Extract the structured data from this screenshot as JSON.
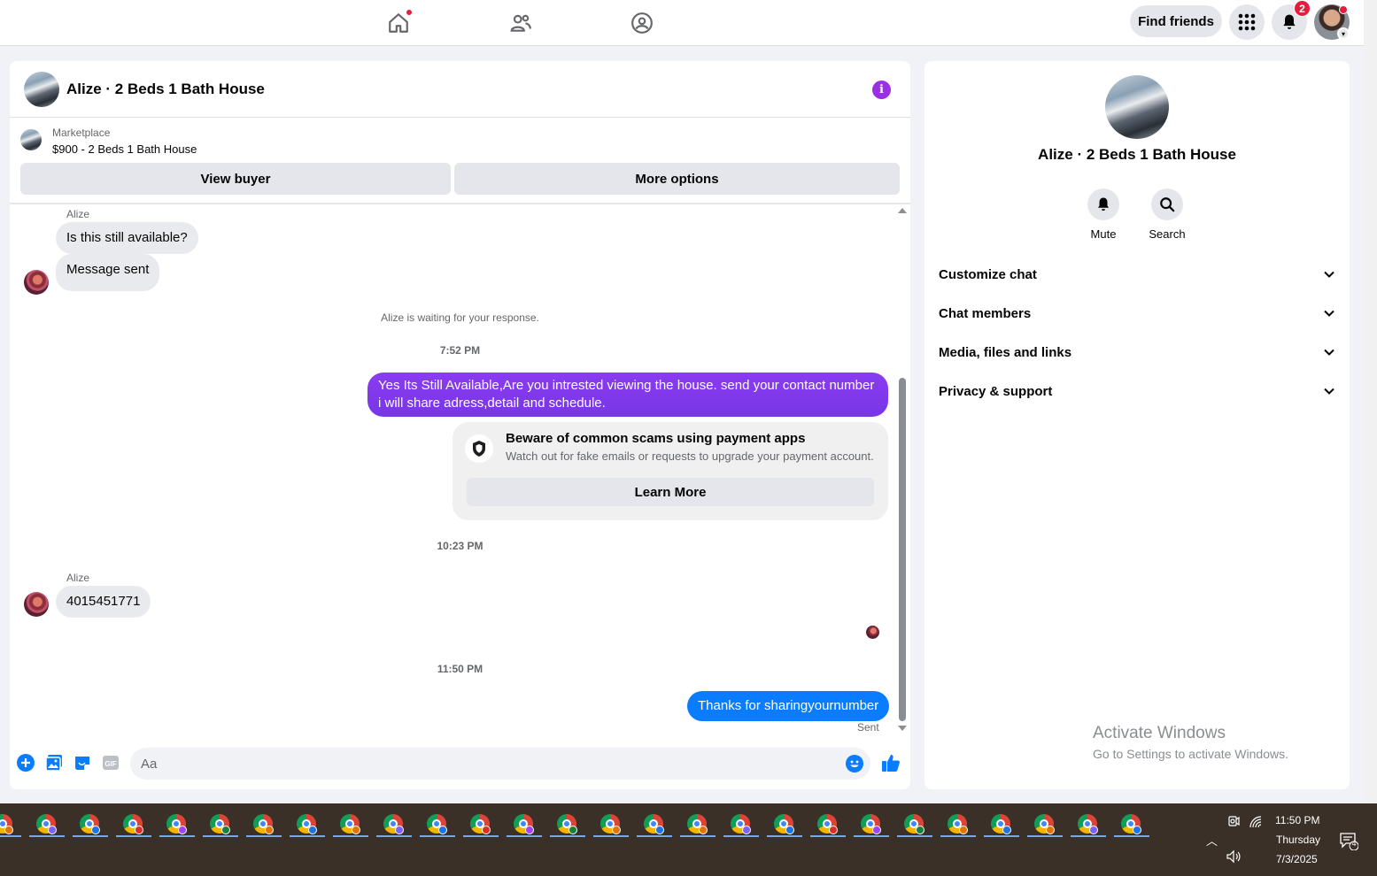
{
  "topbar": {
    "find_friends": "Find friends",
    "notification_count": "2",
    "nav_icons": [
      "home-icon",
      "friends-icon",
      "groups-icon"
    ]
  },
  "chat": {
    "title": "Alize · 2 Beds 1 Bath House",
    "marketplace_label": "Marketplace",
    "listing": "$900 - 2 Beds 1 Bath House",
    "view_buyer": "View buyer",
    "more_options": "More options",
    "messages": {
      "sender1": "Alize",
      "m1": "Is this still available?",
      "m2": "Message sent",
      "waiting": "Alize is waiting for your response.",
      "time1": "7:52 PM",
      "m3": "Yes Its Still Available,Are you intrested viewing the house. send your contact number i will share adress,detail and schedule.",
      "scam_title": "Beware of common scams using payment apps",
      "scam_desc": "Watch out for fake emails or requests to upgrade your payment account.",
      "learn_more": "Learn More",
      "time2": "10:23 PM",
      "sender2": "Alize",
      "m4": "4015451771",
      "time3": "11:50 PM",
      "m5": "Thanks for sharingyournumber",
      "sent": "Sent"
    },
    "composer_placeholder": "Aa"
  },
  "panel": {
    "title": "Alize · 2 Beds 1 Bath House",
    "mute": "Mute",
    "search": "Search",
    "sections": [
      "Customize chat",
      "Chat members",
      "Media, files and links",
      "Privacy & support"
    ]
  },
  "watermark": {
    "line1": "Activate Windows",
    "line2": "Go to Settings to activate Windows."
  },
  "taskbar": {
    "time": "11:50 PM",
    "day": "Thursday",
    "date": "7/3/2025",
    "notif_count": "4"
  },
  "colors": {
    "accent_purple": "#7c3ce8",
    "outgoing_blue": "#0a7cff",
    "notification_red": "#e41e3f",
    "taskbar": "#3a3027"
  }
}
